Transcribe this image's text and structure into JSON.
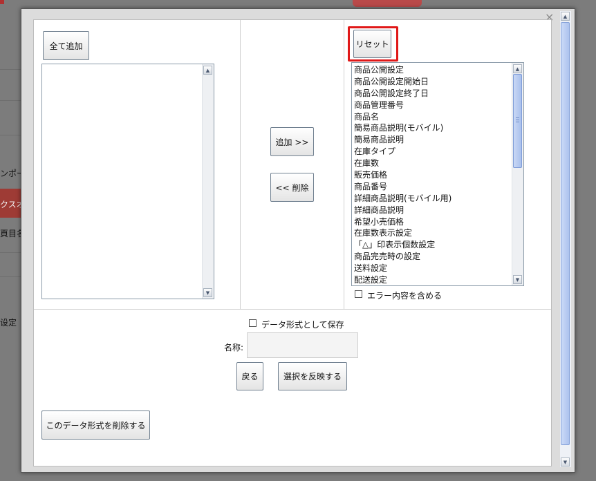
{
  "background": {
    "text_1": "ンポー",
    "text_2": "クスオ",
    "text_3": "頁目名",
    "text_4": "设定"
  },
  "dialog": {
    "close_label": "×",
    "add_all_label": "全て追加",
    "reset_label": "リセット",
    "add_label": "追加 >>",
    "remove_label": "<< 削除",
    "selected_items": [
      "商品公開設定",
      "商品公開設定開始日",
      "商品公開設定終了日",
      "商品管理番号",
      "商品名",
      "簡易商品説明(モバイル)",
      "簡易商品説明",
      "在庫タイプ",
      "在庫数",
      "販売価格",
      "商品番号",
      "詳細商品説明(モバイル用)",
      "詳細商品説明",
      "希望小売価格",
      "在庫数表示設定",
      "「△」印表示個数設定",
      "商品完売時の設定",
      "送料設定",
      "配送設定"
    ],
    "include_errors_label": "エラー内容を含める",
    "save_as_format_label": "データ形式として保存",
    "name_label": "名称:",
    "name_value": "",
    "back_label": "戻る",
    "apply_label": "選択を反映する",
    "delete_format_label": "このデータ形式を削除する"
  },
  "colors": {
    "highlight": "#e01818",
    "scroll_thumb": "#a9c0ec"
  }
}
